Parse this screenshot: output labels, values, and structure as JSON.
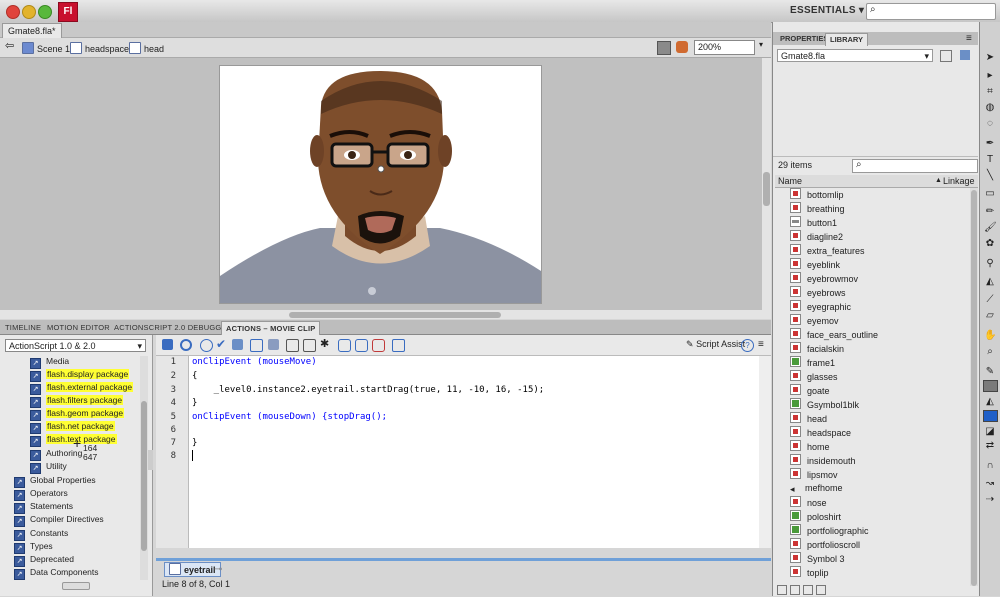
{
  "app": {
    "logo_text": "Fl",
    "workspace": "ESSENTIALS"
  },
  "document": {
    "tab_title": "Gmate8.fla*"
  },
  "editbar": {
    "crumbs": [
      "Scene 1",
      "headspace",
      "head"
    ],
    "zoom": "200%"
  },
  "panels": {
    "tabs": [
      "TIMELINE",
      "MOTION EDITOR",
      "ACTIONSCRIPT 2.0 DEBUGGER",
      "ACTIONS – MOVIE CLIP"
    ],
    "active_tab": "ACTIONS – MOVIE CLIP"
  },
  "actions": {
    "version": "ActionScript 1.0 & 2.0",
    "script_assist": "Script Assist",
    "tree": [
      {
        "label": "Media",
        "highlight": false,
        "indent": 2
      },
      {
        "label": "flash.display package",
        "highlight": true,
        "indent": 2
      },
      {
        "label": "flash.external package",
        "highlight": true,
        "indent": 2
      },
      {
        "label": "flash.filters package",
        "highlight": true,
        "indent": 2
      },
      {
        "label": "flash.geom package",
        "highlight": true,
        "indent": 2
      },
      {
        "label": "flash.net package",
        "highlight": true,
        "indent": 2
      },
      {
        "label": "flash.text package",
        "highlight": true,
        "indent": 2
      },
      {
        "label": "Authoring",
        "highlight": false,
        "indent": 2
      },
      {
        "label": "Utility",
        "highlight": false,
        "indent": 2
      },
      {
        "label": "Global Properties",
        "highlight": false,
        "indent": 1
      },
      {
        "label": "Operators",
        "highlight": false,
        "indent": 1
      },
      {
        "label": "Statements",
        "highlight": false,
        "indent": 1
      },
      {
        "label": "Compiler Directives",
        "highlight": false,
        "indent": 1
      },
      {
        "label": "Constants",
        "highlight": false,
        "indent": 1
      },
      {
        "label": "Types",
        "highlight": false,
        "indent": 1
      },
      {
        "label": "Deprecated",
        "highlight": false,
        "indent": 1
      },
      {
        "label": "Data Components",
        "highlight": false,
        "indent": 1
      }
    ],
    "cursor_tooltip": [
      "164",
      "647"
    ],
    "line_numbers": [
      "1",
      "2",
      "3",
      "4",
      "5",
      "6",
      "7",
      "8"
    ],
    "code": [
      "onClipEvent (mouseMove)",
      "{",
      "    _level0.instance2.eyetrail.startDrag(true, 11, -10, 16, -15);",
      "}",
      "onClipEvent (mouseDown) {stopDrag();",
      "",
      "}",
      ""
    ],
    "instance_tab": "eyetrail",
    "status": "Line 8 of 8, Col 1"
  },
  "right_panel": {
    "tabs": [
      "PROPERTIES",
      "LIBRARY"
    ],
    "library_file": "Gmate8.fla",
    "item_count": "29 items",
    "col_name": "Name",
    "col_linkage": "Linkage",
    "items": [
      {
        "name": "bottomlip",
        "icon": "movieclip"
      },
      {
        "name": "breathing",
        "icon": "movieclip"
      },
      {
        "name": "button1",
        "icon": "button"
      },
      {
        "name": "diagline2",
        "icon": "movieclip"
      },
      {
        "name": "extra_features",
        "icon": "movieclip"
      },
      {
        "name": "eyeblink",
        "icon": "movieclip"
      },
      {
        "name": "eyebrowmov",
        "icon": "movieclip"
      },
      {
        "name": "eyebrows",
        "icon": "movieclip"
      },
      {
        "name": "eyegraphic",
        "icon": "movieclip"
      },
      {
        "name": "eyemov",
        "icon": "movieclip"
      },
      {
        "name": "face_ears_outline",
        "icon": "movieclip"
      },
      {
        "name": "facialskin",
        "icon": "movieclip"
      },
      {
        "name": "frame1",
        "icon": "graphic"
      },
      {
        "name": "glasses",
        "icon": "movieclip"
      },
      {
        "name": "goate",
        "icon": "movieclip"
      },
      {
        "name": "Gsymbol1blk",
        "icon": "graphic"
      },
      {
        "name": "head",
        "icon": "movieclip"
      },
      {
        "name": "headspace",
        "icon": "movieclip"
      },
      {
        "name": "home",
        "icon": "movieclip"
      },
      {
        "name": "insidemouth",
        "icon": "movieclip"
      },
      {
        "name": "lipsmov",
        "icon": "movieclip"
      },
      {
        "name": "mefhome",
        "icon": "sound"
      },
      {
        "name": "nose",
        "icon": "movieclip"
      },
      {
        "name": "poloshirt",
        "icon": "graphic"
      },
      {
        "name": "portfoliographic",
        "icon": "graphic"
      },
      {
        "name": "portfolioscroll",
        "icon": "movieclip"
      },
      {
        "name": "Symbol 3",
        "icon": "movieclip"
      },
      {
        "name": "toplip",
        "icon": "movieclip"
      }
    ]
  },
  "colors": {
    "highlight": "#ffff33",
    "keyword": "#0000ff",
    "skin": "#7a4a2a",
    "shirt": "#8a90a0"
  }
}
